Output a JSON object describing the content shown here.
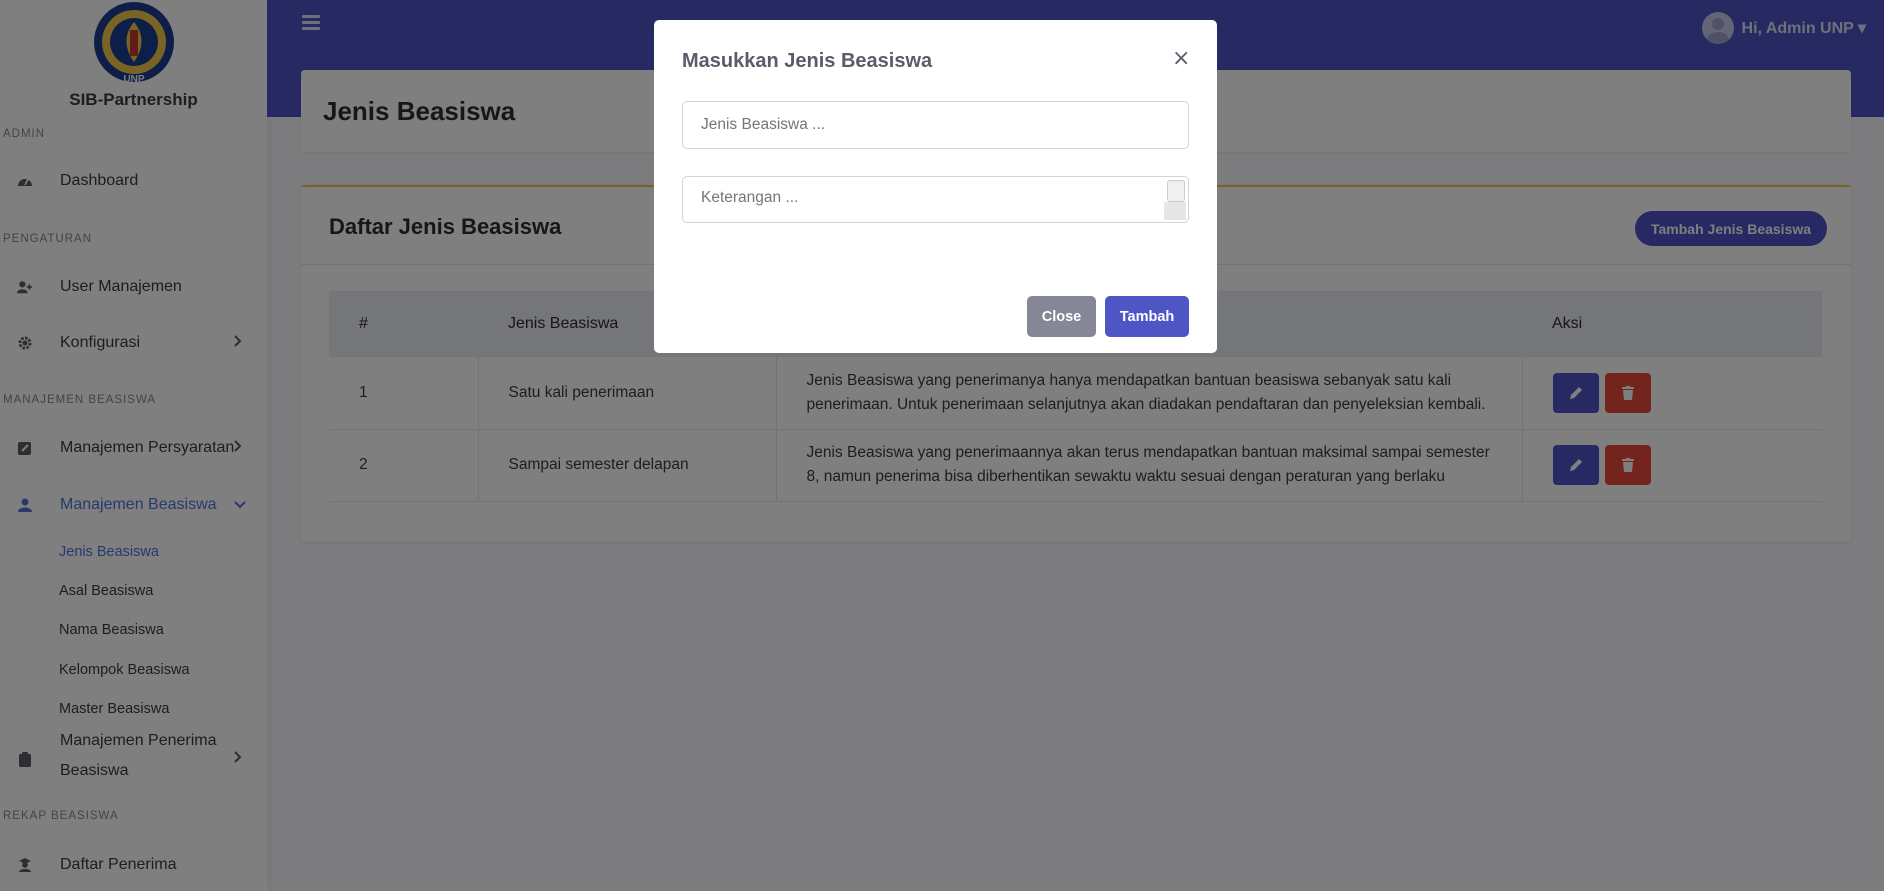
{
  "brand": {
    "name": "SIB-Partnership",
    "logo_text": "UNP"
  },
  "topbar": {
    "user_greeting": "Hi, Admin UNP ▾"
  },
  "sidebar": {
    "sections": {
      "admin": "ADMIN",
      "pengaturan": "PENGATURAN",
      "manajemen_beasiswa": "MANAJEMEN BEASISWA",
      "rekap_beasiswa": "REKAP BEASISWA"
    },
    "items": {
      "dashboard": "Dashboard",
      "user_manajemen": "User Manajemen",
      "konfigurasi": "Konfigurasi",
      "manajemen_persyaratan": "Manajemen Persyaratan",
      "manajemen_beasiswa": "Manajemen Beasiswa",
      "manajemen_penerima_1": "Manajemen Penerima",
      "manajemen_penerima_2": "Beasiswa",
      "daftar_penerima": "Daftar Penerima"
    },
    "subitems": {
      "jenis_beasiswa": "Jenis Beasiswa",
      "asal_beasiswa": "Asal Beasiswa",
      "nama_beasiswa": "Nama Beasiswa",
      "kelompok_beasiswa": "Kelompok Beasiswa",
      "master_beasiswa": "Master Beasiswa"
    }
  },
  "page": {
    "title": "Jenis Beasiswa"
  },
  "card": {
    "title": "Daftar Jenis Beasiswa",
    "add_button": "Tambah Jenis Beasiswa"
  },
  "table": {
    "headers": {
      "no": "#",
      "jenis": "Jenis Beasiswa",
      "aksi": "Aksi"
    },
    "rows": [
      {
        "no": "1",
        "jenis": "Satu kali penerimaan",
        "keterangan": "Jenis Beasiswa yang penerimanya hanya mendapatkan bantuan beasiswa sebanyak satu kali penerimaan. Untuk penerimaan selanjutnya akan diadakan pendaftaran dan penyeleksian kembali."
      },
      {
        "no": "2",
        "jenis": "Sampai semester delapan",
        "keterangan": "Jenis Beasiswa yang penerimaannya akan terus mendapatkan bantuan maksimal sampai semester 8, namun penerima bisa diberhentikan sewaktu waktu sesuai dengan peraturan yang berlaku"
      }
    ]
  },
  "modal": {
    "title": "Masukkan Jenis Beasiswa",
    "close_x": "×",
    "jenis_placeholder": "Jenis Beasiswa ...",
    "keterangan_placeholder": "Keterangan ...",
    "close_button": "Close",
    "tambah_button": "Tambah"
  },
  "colors": {
    "primary": "#4e55c5",
    "danger": "#e74a3b",
    "warning": "#f6c23e"
  }
}
